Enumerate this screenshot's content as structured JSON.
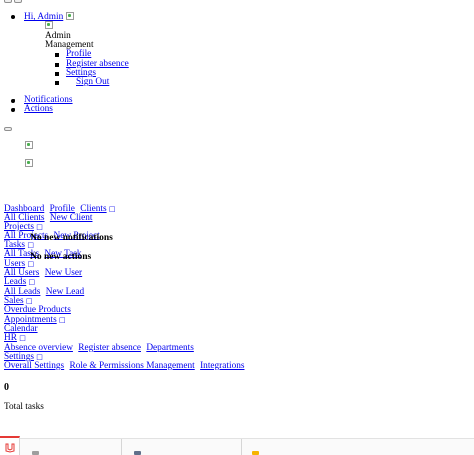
{
  "top_nav": {
    "greeting": "Hi, Admin",
    "avatar_alt": "Admin",
    "role": "Management",
    "menu": [
      "Profile",
      "Register absence",
      "Settings",
      "Sign Out"
    ],
    "links": [
      "Notifications",
      "Actions"
    ]
  },
  "notifications_panel": {
    "empty_text": "No new notifications"
  },
  "actions_panel": {
    "empty_text": "No new actions"
  },
  "sidebar": {
    "row1": [
      "Dashboard",
      "Profile",
      "Clients"
    ],
    "clients": [
      "All Clients",
      "New Client"
    ],
    "projects_header": "Projects",
    "projects": [
      "All Projects",
      "New Project"
    ],
    "tasks_header": "Tasks",
    "tasks": [
      "All Tasks",
      "New Task"
    ],
    "users_header": "Users",
    "users": [
      "All Users",
      "New User"
    ],
    "leads_header": "Leads",
    "leads": [
      "All Leads",
      "New Lead"
    ],
    "sales_header": "Sales",
    "sales": [
      "Overdue Products"
    ],
    "appointments_header": "Appointments",
    "calendar": "Calendar",
    "hr_header": "HR",
    "hr": [
      "Absence overview",
      "Register absence",
      "Departments"
    ],
    "settings_header": "Settings",
    "settings": [
      "Overall Settings",
      "Role & Permissions Management",
      "Integrations"
    ],
    "chevron_icon": "chevron-down-icon"
  },
  "stats": {
    "total_tasks_value": "0",
    "total_tasks_label": "Total tasks"
  },
  "bottom_tabs": {
    "accent": "#e53935"
  }
}
